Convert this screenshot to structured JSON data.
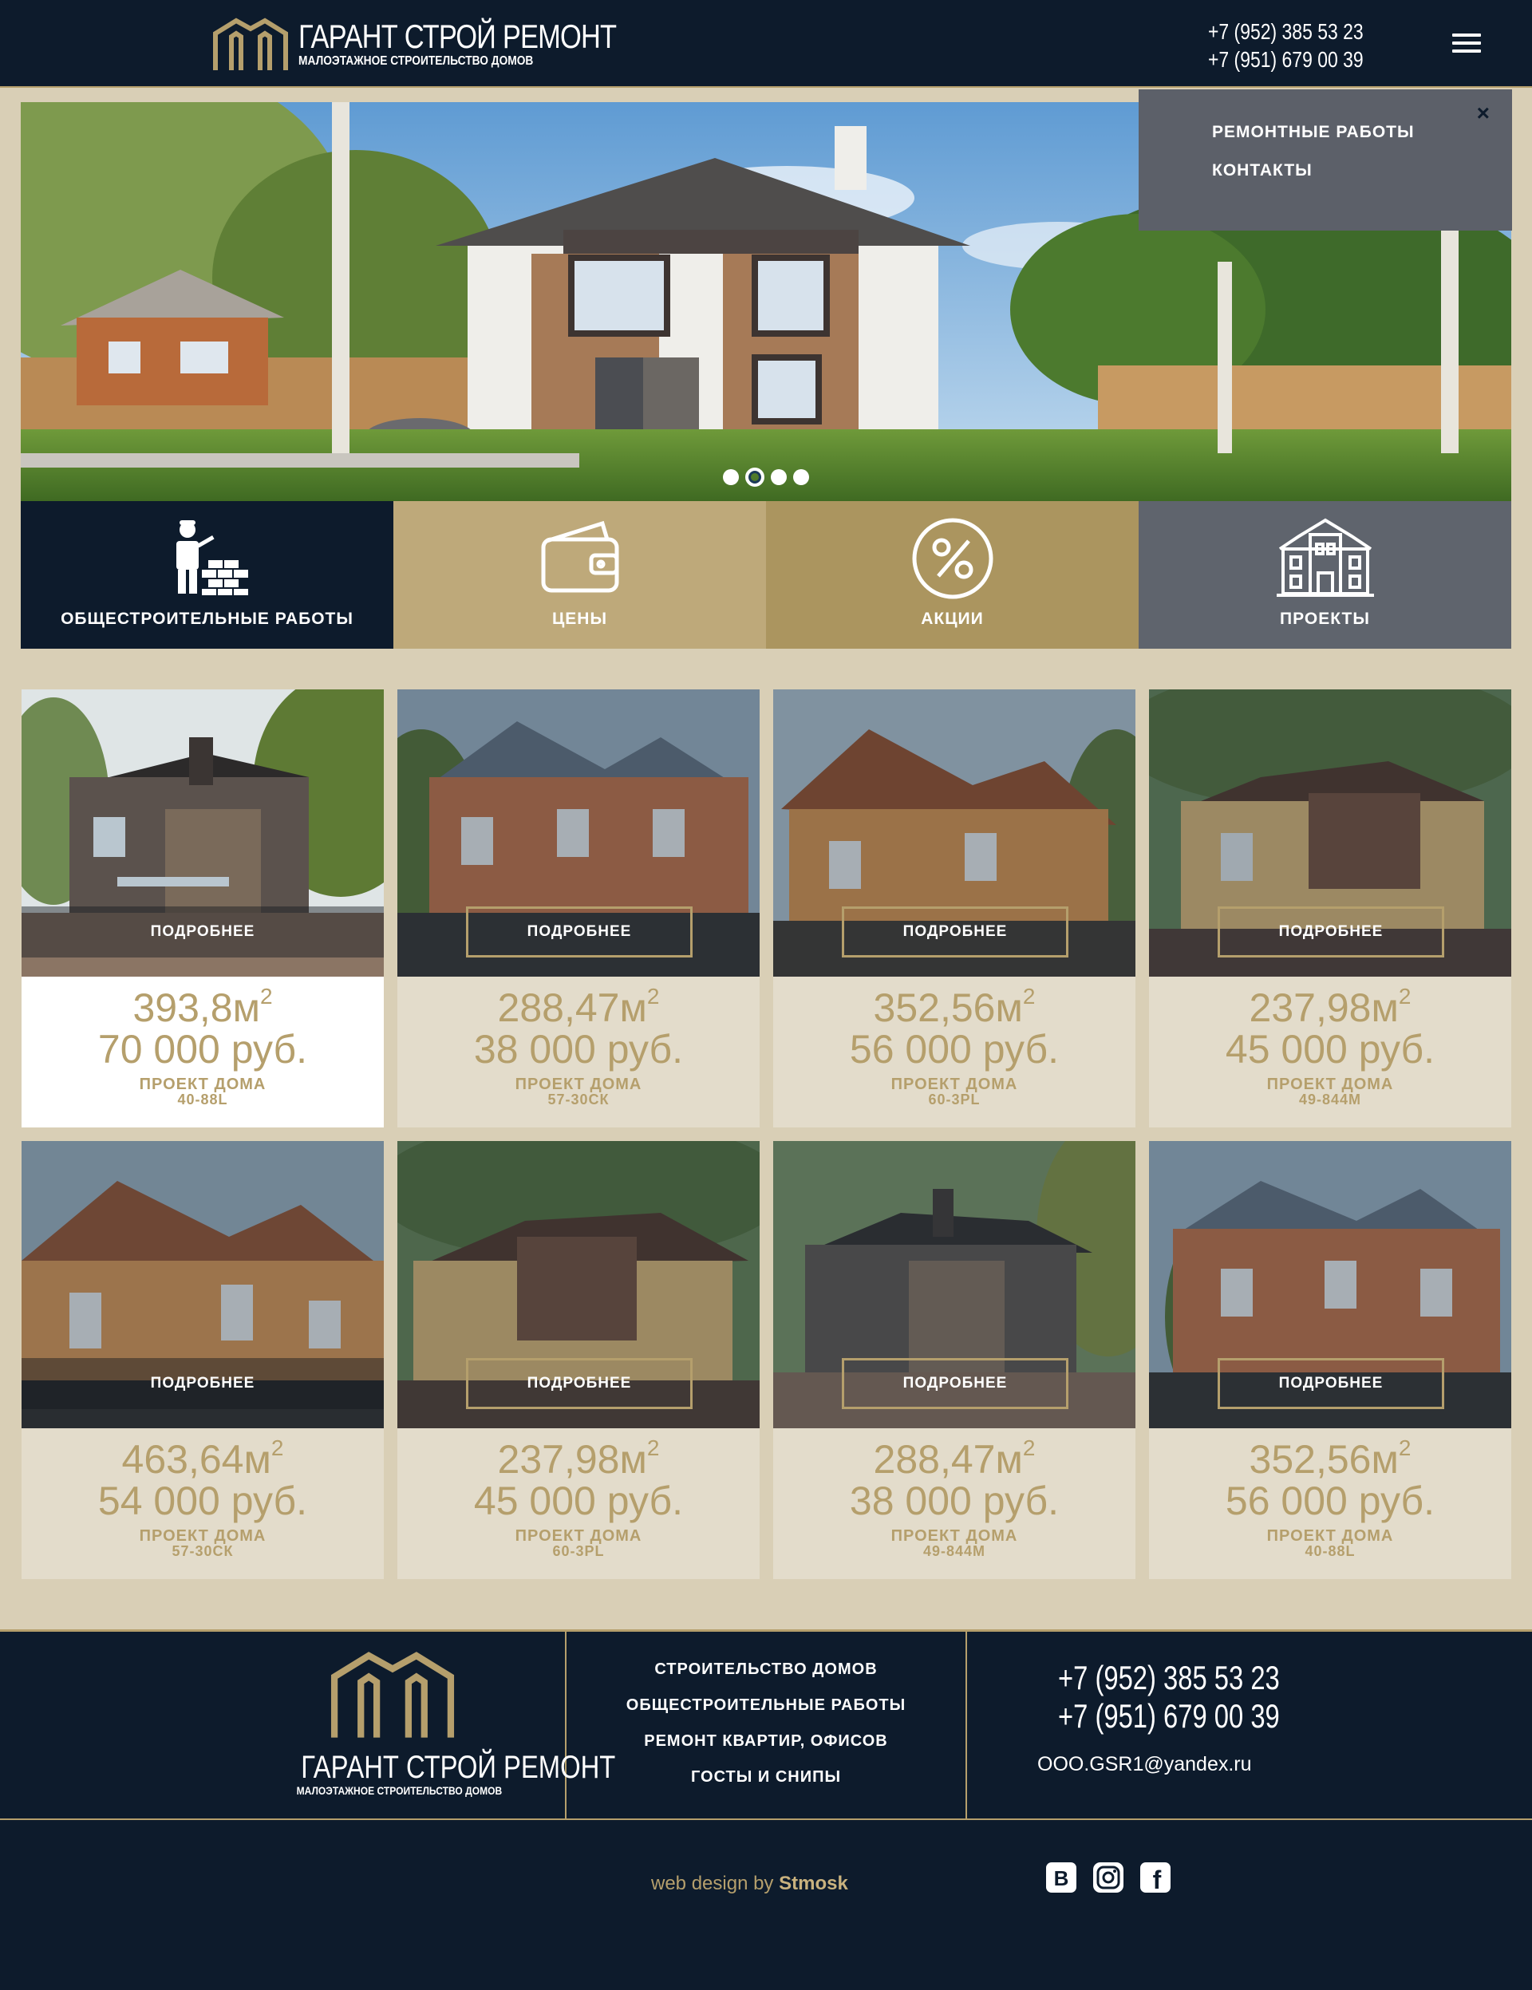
{
  "header": {
    "brand_title": "ГАРАНТ СТРОЙ РЕМОНТ",
    "brand_subtitle": "МАЛОЭТАЖНОЕ СТРОИТЕЛЬСТВО ДОМОВ",
    "phone_1": "+7 (952) 385 53 23",
    "phone_2": "+7 (951) 679 00 39",
    "menu_icon": "hamburger-icon"
  },
  "menu": {
    "close_label": "×",
    "items": [
      {
        "label": "РЕМОНТНЫЕ РАБОТЫ"
      },
      {
        "label": "КОНТАКТЫ"
      }
    ]
  },
  "slider": {
    "slide_count": 4,
    "active_index": 1
  },
  "tiles": [
    {
      "label": "ОБЩЕСТРОИТЕЛЬНЫЕ РАБОТЫ",
      "icon": "builder-icon",
      "color": "#0d1b2c"
    },
    {
      "label": "ЦЕНЫ",
      "icon": "wallet-icon",
      "color": "#bea97a"
    },
    {
      "label": "АКЦИИ",
      "icon": "percent-icon",
      "color": "#ab955f"
    },
    {
      "label": "ПРОЕКТЫ",
      "icon": "building-icon",
      "color": "#5f646d"
    }
  ],
  "projects": {
    "more_label": "ПОДРОБНЕЕ",
    "type_label": "ПРОЕКТ ДОМА",
    "area_unit": "м",
    "area_exp": "2",
    "items": [
      {
        "area": "393,8",
        "price": "70 000 руб.",
        "code": "40-88L"
      },
      {
        "area": "288,47",
        "price": "38 000 руб.",
        "code": "57-30СК"
      },
      {
        "area": "352,56",
        "price": "56 000 руб.",
        "code": "60-3PL"
      },
      {
        "area": "237,98",
        "price": "45 000 руб.",
        "code": "49-844М"
      },
      {
        "area": "463,64",
        "price": "54 000 руб.",
        "code": "57-30СК"
      },
      {
        "area": "237,98",
        "price": "45 000 руб.",
        "code": "60-3PL"
      },
      {
        "area": "288,47",
        "price": "38 000 руб.",
        "code": "49-844М"
      },
      {
        "area": "352,56",
        "price": "56 000 руб.",
        "code": "40-88L"
      }
    ]
  },
  "footer": {
    "brand_title": "ГАРАНТ СТРОЙ РЕМОНТ",
    "brand_subtitle": "МАЛОЭТАЖНОЕ СТРОИТЕЛЬСТВО ДОМОВ",
    "links": [
      {
        "label": "СТРОИТЕЛЬСТВО ДОМОВ"
      },
      {
        "label": "ОБЩЕСТРОИТЕЛЬНЫЕ РАБОТЫ"
      },
      {
        "label": "РЕМОНТ КВАРТИР, ОФИСОВ"
      },
      {
        "label": "ГОСТЫ И СНИПЫ"
      }
    ],
    "phone_1": "+7 (952) 385 53 23",
    "phone_2": "+7 (951) 679 00 39",
    "email": "OOO.GSR1@yandex.ru",
    "credit_prefix": "web design by",
    "credit_name": "Stmosk",
    "social": [
      {
        "icon": "vk-icon",
        "glyph": "В"
      },
      {
        "icon": "instagram-icon"
      },
      {
        "icon": "facebook-icon",
        "glyph": "f"
      }
    ]
  },
  "colors": {
    "navy": "#0d1b2c",
    "gold": "#b59f6c",
    "beige_bg": "#d9cfb6",
    "card_bg": "#e3dccb"
  }
}
